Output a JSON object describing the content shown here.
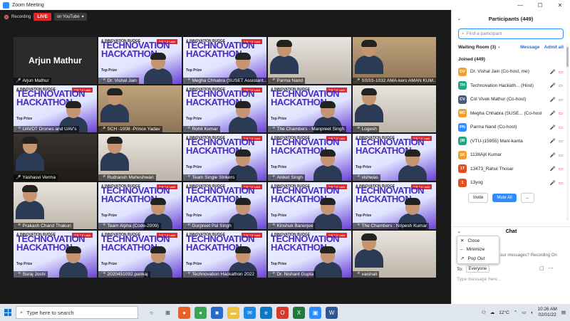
{
  "window": {
    "title": "Zoom Meeting",
    "min": "—",
    "max": "☐",
    "close": "✕"
  },
  "topbar": {
    "recording": "Recording",
    "live": "LIVE",
    "youtube": "on YouTube",
    "youtube_caret": "▾"
  },
  "tiles": [
    {
      "name": "Arjun Mathur",
      "style": "black",
      "big": "Arjun Mathur"
    },
    {
      "name": "Dr. Vishal Jain",
      "style": "hack"
    },
    {
      "name": "Megha Chhabra (SUSET Assistant...",
      "style": "hack"
    },
    {
      "name": "Parma Nand",
      "style": "office"
    },
    {
      "name": "SSSS-1032 AMA-kers AMAN KUM...",
      "style": "room"
    },
    {
      "name": "UAVDT Drones and UAV's",
      "style": "hack"
    },
    {
      "name": "SCH -1008 -Prince Yadav",
      "style": "room"
    },
    {
      "name": "Rohit Kumar",
      "style": "hack"
    },
    {
      "name": "The Chambers - Manpreet Singh",
      "style": "hack"
    },
    {
      "name": "Logesh",
      "style": "office"
    },
    {
      "name": "Yashasvi Verma",
      "style": "dark"
    },
    {
      "name": "Rudransh Maheshwari",
      "style": "office"
    },
    {
      "name": "Team Single Strikers",
      "style": "hack"
    },
    {
      "name": "Aniket Singh",
      "style": "hack"
    },
    {
      "name": "vishwas",
      "style": "hack"
    },
    {
      "name": "Prakash Chand Thakuri",
      "style": "office"
    },
    {
      "name": "Team Alpha (Code-2009)",
      "style": "hack"
    },
    {
      "name": "Gurpreet Pal Singh",
      "style": "hack"
    },
    {
      "name": "Kinshuk Banerjee",
      "style": "hack"
    },
    {
      "name": "The Chambers : Nripesh Kumar",
      "style": "hack"
    },
    {
      "name": "Suraj Joshi",
      "style": "hack"
    },
    {
      "name": "2020451092.pankaj",
      "style": "hack"
    },
    {
      "name": "Technovation Hackathon 2022",
      "style": "hack"
    },
    {
      "name": "Dr. Nishant Gupta",
      "style": "hack"
    },
    {
      "name": "vaishali",
      "style": "office"
    }
  ],
  "hackathon": {
    "title_line1": "TECHNOVATION",
    "title_line2": "HACKATHON",
    "subtitle": "& INNOVATION BUDGE",
    "prize": "Top Prize",
    "badge": "INR 5.5 Lakh"
  },
  "participants": {
    "title": "Participants (449)",
    "search_placeholder": "Find a participant",
    "waiting_room": "Waiting Room (3)",
    "waiting_caret": "›",
    "message": "Message",
    "admit_all": "Admit all",
    "joined": "Joined (449)",
    "list": [
      {
        "initials": "DV",
        "name": "Dr. Vishal Jain (Co-host, me)",
        "color": "#f0a030"
      },
      {
        "initials": "TH",
        "name": "Technovation Hackath... (Host)",
        "color": "#20a880"
      },
      {
        "initials": "CV",
        "name": "Col Vivek Mathur (Co-host)",
        "color": "#4a5a78"
      },
      {
        "initials": "MC",
        "name": "Megha Chhabra (SUSE... (Co-host)",
        "color": "#f0a030"
      },
      {
        "initials": "PN",
        "name": "Parma Nand (Co-host)",
        "color": "#2d8cff"
      },
      {
        "initials": "(M",
        "name": "(VTU-)15955) Mani-kanta",
        "color": "#20a880"
      },
      {
        "initials": "1K",
        "name": "1138Ajit Kumar",
        "color": "#f0a030"
      },
      {
        "initials": "1T",
        "name": "13473_Rahul Thosar",
        "color": "#e05020"
      },
      {
        "initials": "1",
        "name": "13yog",
        "color": "#e05020"
      }
    ],
    "invite": "Invite",
    "mute_all": "Mute All",
    "more": "..."
  },
  "chat": {
    "title": "Chat",
    "note": "our messages? Recording On",
    "to_label": "To:",
    "to_value": "Everyone",
    "placeholder": "Type message here...",
    "menu": [
      {
        "icon": "✕",
        "label": "Close"
      },
      {
        "icon": "–",
        "label": "Minimize"
      },
      {
        "icon": "↗",
        "label": "Pop Out"
      }
    ]
  },
  "taskbar": {
    "search": "Type here to search",
    "temperature": "12°C",
    "time": "10:26 AM",
    "date": "02/01/22"
  }
}
